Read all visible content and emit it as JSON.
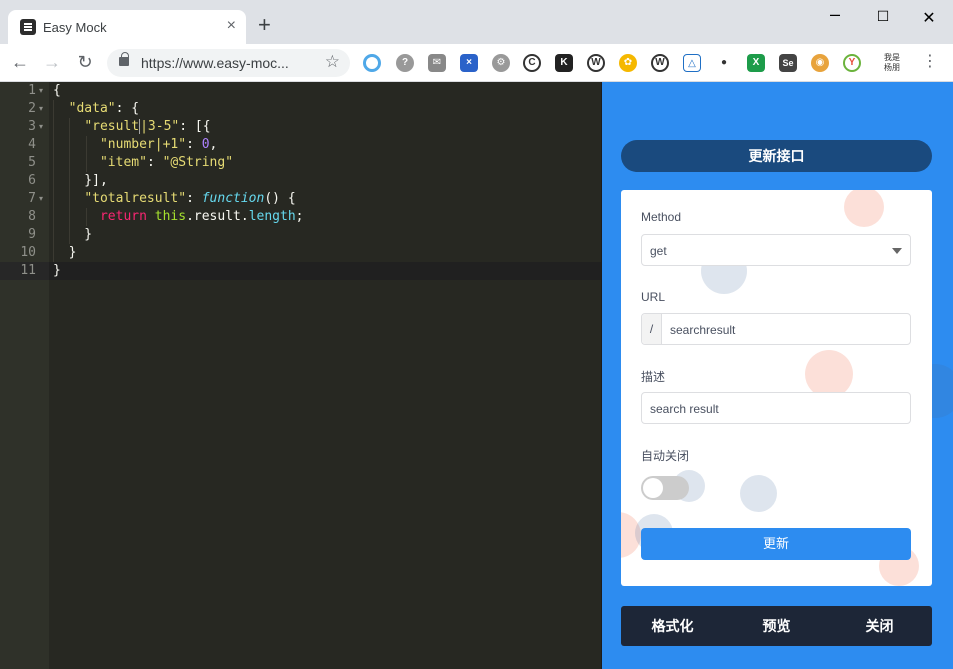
{
  "browser": {
    "tab_title": "Easy Mock",
    "tab_close": "×",
    "new_tab": "+",
    "url": "https://www.easy-moc...",
    "user_label_1": "我是",
    "user_label_2": "杨朋"
  },
  "editor": {
    "line_numbers": [
      "1",
      "2",
      "3",
      "4",
      "5",
      "6",
      "7",
      "8",
      "9",
      "10",
      "11"
    ]
  },
  "panel": {
    "title": "更新接口",
    "method_label": "Method",
    "method_value": "get",
    "url_label": "URL",
    "url_prefix": "/",
    "url_value": "searchresult",
    "desc_label": "描述",
    "desc_value": "search result",
    "auto_close_label": "自动关闭",
    "auto_close_enabled": false,
    "submit_label": "更新",
    "bottom_actions": [
      "格式化",
      "预览",
      "关闭"
    ]
  },
  "colors": {
    "accent": "#2d8cf0",
    "title_bar": "#1a4a7e",
    "bottom_bar": "#1d2637",
    "editor_bg": "#272822"
  }
}
